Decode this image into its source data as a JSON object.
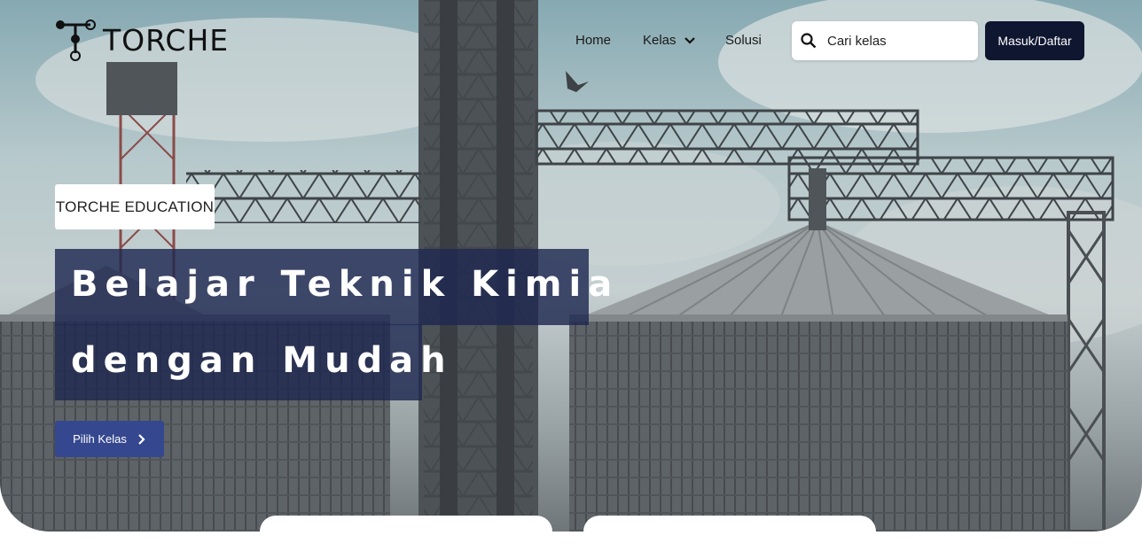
{
  "brand": {
    "name": "TORCHE"
  },
  "nav": {
    "home": "Home",
    "kelas": "Kelas",
    "solusi": "Solusi"
  },
  "search": {
    "placeholder": "Cari kelas",
    "icon": "search-icon"
  },
  "auth": {
    "login_label": "Masuk/Daftar"
  },
  "hero": {
    "tag": "TORCHE EDUCATION",
    "headline_line1": "Belajar Teknik Kimia",
    "headline_line2": "dengan Mudah",
    "cta_label": "Pilih Kelas",
    "cta_icon": "chevron-right-icon"
  },
  "colors": {
    "brand_dark": "#0f1630",
    "accent_blue": "#35478f",
    "headline_bg": "#1e2850"
  }
}
